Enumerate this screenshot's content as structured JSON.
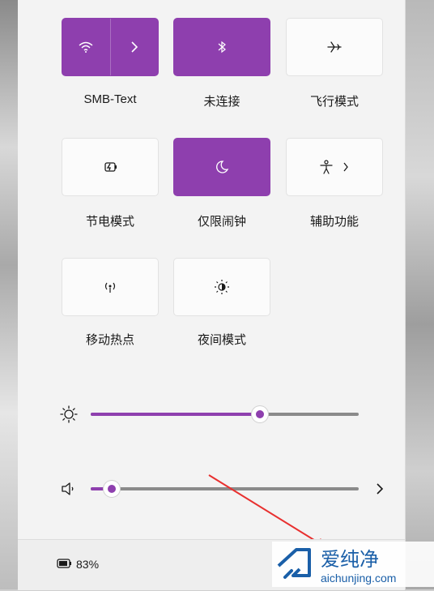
{
  "quick_settings": {
    "tiles": [
      {
        "label": "SMB-Text",
        "icon": "wifi-icon",
        "active": true
      },
      {
        "label": "未连接",
        "icon": "bluetooth-icon",
        "active": true
      },
      {
        "label": "飞行模式",
        "icon": "airplane-icon",
        "active": false
      },
      {
        "label": "节电模式",
        "icon": "battery-saver-icon",
        "active": false
      },
      {
        "label": "仅限闹钟",
        "icon": "moon-icon",
        "active": true
      },
      {
        "label": "辅助功能",
        "icon": "accessibility-icon",
        "active": false
      },
      {
        "label": "移动热点",
        "icon": "hotspot-icon",
        "active": false
      },
      {
        "label": "夜间模式",
        "icon": "night-light-icon",
        "active": false
      }
    ]
  },
  "sliders": {
    "brightness": {
      "icon": "brightness-icon",
      "value_percent": 63
    },
    "volume": {
      "icon": "speaker-icon",
      "value_percent": 8
    }
  },
  "footer": {
    "battery_text": "83%"
  },
  "watermark": {
    "site_name": "爱纯净",
    "url": "aichunjing.com"
  },
  "colors": {
    "accent": "#8e3fae",
    "panel": "#f3f3f3",
    "tile": "#fbfbfb"
  }
}
